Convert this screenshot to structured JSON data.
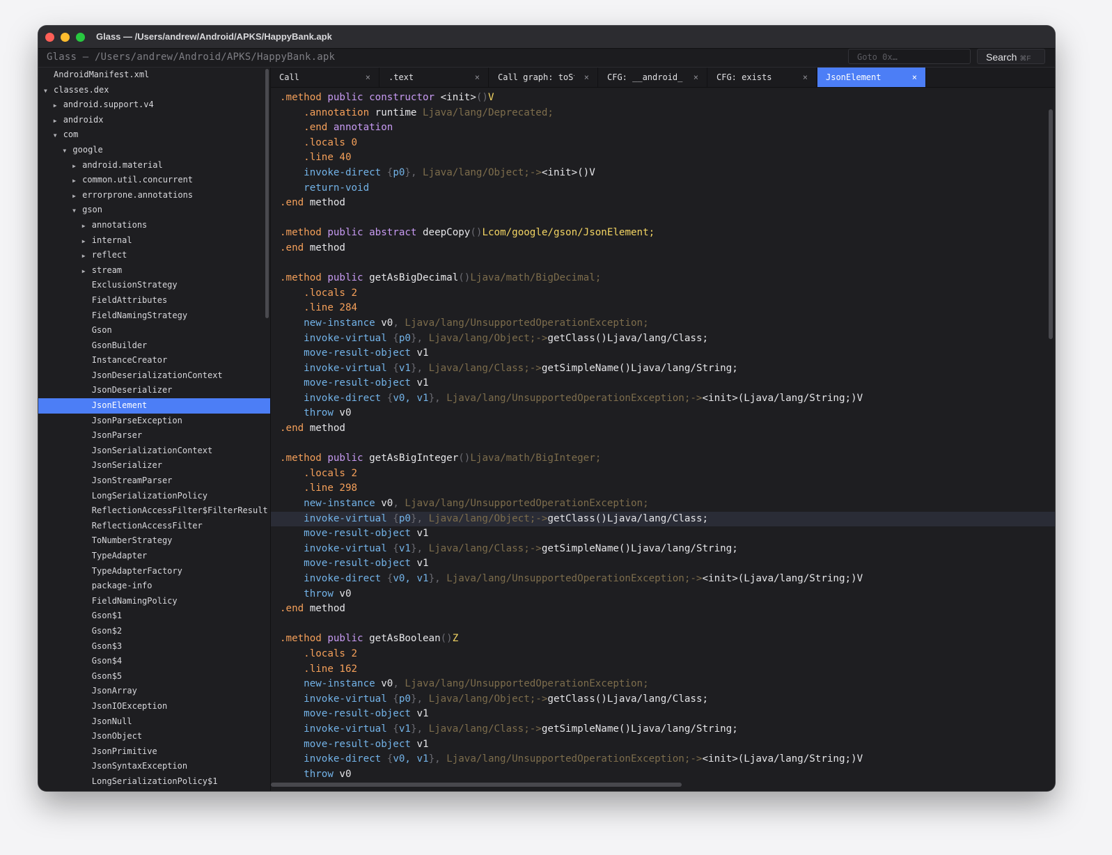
{
  "window": {
    "title": "Glass — /Users/andrew/Android/APKS/HappyBank.apk"
  },
  "pathbar": {
    "path": "Glass — /Users/andrew/Android/APKS/HappyBank.apk",
    "goto_placeholder": "Goto 0x…",
    "search_label": "Search",
    "search_shortcut": "⌘F"
  },
  "tree": [
    {
      "label": "AndroidManifest.xml",
      "depth": 0,
      "arrow": ""
    },
    {
      "label": "classes.dex",
      "depth": 0,
      "arrow": "down"
    },
    {
      "label": "android.support.v4",
      "depth": 1,
      "arrow": "right"
    },
    {
      "label": "androidx",
      "depth": 1,
      "arrow": "right"
    },
    {
      "label": "com",
      "depth": 1,
      "arrow": "down"
    },
    {
      "label": "google",
      "depth": 2,
      "arrow": "down"
    },
    {
      "label": "android.material",
      "depth": 3,
      "arrow": "right"
    },
    {
      "label": "common.util.concurrent",
      "depth": 3,
      "arrow": "right"
    },
    {
      "label": "errorprone.annotations",
      "depth": 3,
      "arrow": "right"
    },
    {
      "label": "gson",
      "depth": 3,
      "arrow": "down"
    },
    {
      "label": "annotations",
      "depth": 4,
      "arrow": "right"
    },
    {
      "label": "internal",
      "depth": 4,
      "arrow": "right"
    },
    {
      "label": "reflect",
      "depth": 4,
      "arrow": "right"
    },
    {
      "label": "stream",
      "depth": 4,
      "arrow": "right"
    },
    {
      "label": "ExclusionStrategy",
      "depth": 4,
      "arrow": ""
    },
    {
      "label": "FieldAttributes",
      "depth": 4,
      "arrow": ""
    },
    {
      "label": "FieldNamingStrategy",
      "depth": 4,
      "arrow": ""
    },
    {
      "label": "Gson",
      "depth": 4,
      "arrow": ""
    },
    {
      "label": "GsonBuilder",
      "depth": 4,
      "arrow": ""
    },
    {
      "label": "InstanceCreator",
      "depth": 4,
      "arrow": ""
    },
    {
      "label": "JsonDeserializationContext",
      "depth": 4,
      "arrow": ""
    },
    {
      "label": "JsonDeserializer",
      "depth": 4,
      "arrow": ""
    },
    {
      "label": "JsonElement",
      "depth": 4,
      "arrow": "",
      "selected": true
    },
    {
      "label": "JsonParseException",
      "depth": 4,
      "arrow": ""
    },
    {
      "label": "JsonParser",
      "depth": 4,
      "arrow": ""
    },
    {
      "label": "JsonSerializationContext",
      "depth": 4,
      "arrow": ""
    },
    {
      "label": "JsonSerializer",
      "depth": 4,
      "arrow": ""
    },
    {
      "label": "JsonStreamParser",
      "depth": 4,
      "arrow": ""
    },
    {
      "label": "LongSerializationPolicy",
      "depth": 4,
      "arrow": ""
    },
    {
      "label": "ReflectionAccessFilter$FilterResult",
      "depth": 4,
      "arrow": ""
    },
    {
      "label": "ReflectionAccessFilter",
      "depth": 4,
      "arrow": ""
    },
    {
      "label": "ToNumberStrategy",
      "depth": 4,
      "arrow": ""
    },
    {
      "label": "TypeAdapter",
      "depth": 4,
      "arrow": ""
    },
    {
      "label": "TypeAdapterFactory",
      "depth": 4,
      "arrow": ""
    },
    {
      "label": "package-info",
      "depth": 4,
      "arrow": ""
    },
    {
      "label": "FieldNamingPolicy",
      "depth": 4,
      "arrow": ""
    },
    {
      "label": "Gson$1",
      "depth": 4,
      "arrow": ""
    },
    {
      "label": "Gson$2",
      "depth": 4,
      "arrow": ""
    },
    {
      "label": "Gson$3",
      "depth": 4,
      "arrow": ""
    },
    {
      "label": "Gson$4",
      "depth": 4,
      "arrow": ""
    },
    {
      "label": "Gson$5",
      "depth": 4,
      "arrow": ""
    },
    {
      "label": "JsonArray",
      "depth": 4,
      "arrow": ""
    },
    {
      "label": "JsonIOException",
      "depth": 4,
      "arrow": ""
    },
    {
      "label": "JsonNull",
      "depth": 4,
      "arrow": ""
    },
    {
      "label": "JsonObject",
      "depth": 4,
      "arrow": ""
    },
    {
      "label": "JsonPrimitive",
      "depth": 4,
      "arrow": ""
    },
    {
      "label": "JsonSyntaxException",
      "depth": 4,
      "arrow": ""
    },
    {
      "label": "LongSerializationPolicy$1",
      "depth": 4,
      "arrow": ""
    }
  ],
  "tabs": [
    {
      "label": "Call",
      "close": "×"
    },
    {
      "label": ".text",
      "close": "×"
    },
    {
      "label": "Call graph: toSt",
      "close": "×"
    },
    {
      "label": "CFG: __android_",
      "close": "×"
    },
    {
      "label": "CFG: exists",
      "close": "×"
    },
    {
      "label": "JsonElement",
      "close": "×",
      "active": true
    }
  ],
  "code_lines": [
    [
      [
        "dir",
        ".method "
      ],
      [
        "kw",
        "public constructor "
      ],
      [
        "pl",
        "<init>"
      ],
      [
        "punc",
        "()"
      ],
      [
        "hi",
        "V"
      ]
    ],
    [
      [
        "pl",
        "    "
      ],
      [
        "dir",
        ".annotation "
      ],
      [
        "pl",
        "runtime "
      ],
      [
        "ty",
        "Ljava/lang/Deprecated;"
      ]
    ],
    [
      [
        "pl",
        "    "
      ],
      [
        "dir",
        ".end "
      ],
      [
        "kw",
        "annotation"
      ]
    ],
    [
      [
        "pl",
        "    "
      ],
      [
        "dir",
        ".locals "
      ],
      [
        "num",
        "0"
      ]
    ],
    [
      [
        "pl",
        "    "
      ],
      [
        "dir",
        ".line "
      ],
      [
        "num",
        "40"
      ]
    ],
    [
      [
        "pl",
        "    "
      ],
      [
        "op",
        "invoke-direct "
      ],
      [
        "punc",
        "{"
      ],
      [
        "op",
        "p0"
      ],
      [
        "punc",
        "}, "
      ],
      [
        "ty",
        "Ljava/lang/Object;->"
      ],
      [
        "pl",
        "<init>()V"
      ]
    ],
    [
      [
        "pl",
        "    "
      ],
      [
        "op",
        "return-void"
      ]
    ],
    [
      [
        "dir",
        ".end "
      ],
      [
        "pl",
        "method"
      ]
    ],
    [],
    [
      [
        "dir",
        ".method "
      ],
      [
        "kw",
        "public abstract "
      ],
      [
        "pl",
        "deepCopy"
      ],
      [
        "punc",
        "()"
      ],
      [
        "hi",
        "Lcom/google/gson/JsonElement;"
      ]
    ],
    [
      [
        "dir",
        ".end "
      ],
      [
        "pl",
        "method"
      ]
    ],
    [],
    [
      [
        "dir",
        ".method "
      ],
      [
        "kw",
        "public "
      ],
      [
        "pl",
        "getAsBigDecimal"
      ],
      [
        "punc",
        "()"
      ],
      [
        "ty",
        "Ljava/math/BigDecimal;"
      ]
    ],
    [
      [
        "pl",
        "    "
      ],
      [
        "dir",
        ".locals "
      ],
      [
        "num",
        "2"
      ]
    ],
    [
      [
        "pl",
        "    "
      ],
      [
        "dir",
        ".line "
      ],
      [
        "num",
        "284"
      ]
    ],
    [
      [
        "pl",
        "    "
      ],
      [
        "op",
        "new-instance "
      ],
      [
        "pl",
        "v0"
      ],
      [
        "punc",
        ", "
      ],
      [
        "ty",
        "Ljava/lang/UnsupportedOperationException;"
      ]
    ],
    [
      [
        "pl",
        "    "
      ],
      [
        "op",
        "invoke-virtual "
      ],
      [
        "punc",
        "{"
      ],
      [
        "op",
        "p0"
      ],
      [
        "punc",
        "}, "
      ],
      [
        "ty",
        "Ljava/lang/Object;->"
      ],
      [
        "pl",
        "getClass()Ljava/lang/Class;"
      ]
    ],
    [
      [
        "pl",
        "    "
      ],
      [
        "op",
        "move-result-object "
      ],
      [
        "pl",
        "v1"
      ]
    ],
    [
      [
        "pl",
        "    "
      ],
      [
        "op",
        "invoke-virtual "
      ],
      [
        "punc",
        "{"
      ],
      [
        "op",
        "v1"
      ],
      [
        "punc",
        "}, "
      ],
      [
        "ty",
        "Ljava/lang/Class;->"
      ],
      [
        "pl",
        "getSimpleName()Ljava/lang/String;"
      ]
    ],
    [
      [
        "pl",
        "    "
      ],
      [
        "op",
        "move-result-object "
      ],
      [
        "pl",
        "v1"
      ]
    ],
    [
      [
        "pl",
        "    "
      ],
      [
        "op",
        "invoke-direct "
      ],
      [
        "punc",
        "{"
      ],
      [
        "op",
        "v0, v1"
      ],
      [
        "punc",
        "}, "
      ],
      [
        "ty",
        "Ljava/lang/UnsupportedOperationException;->"
      ],
      [
        "pl",
        "<init>(Ljava/lang/String;)V"
      ]
    ],
    [
      [
        "pl",
        "    "
      ],
      [
        "op",
        "throw "
      ],
      [
        "pl",
        "v0"
      ]
    ],
    [
      [
        "dir",
        ".end "
      ],
      [
        "pl",
        "method"
      ]
    ],
    [],
    [
      [
        "dir",
        ".method "
      ],
      [
        "kw",
        "public "
      ],
      [
        "pl",
        "getAsBigInteger"
      ],
      [
        "punc",
        "()"
      ],
      [
        "ty",
        "Ljava/math/BigInteger;"
      ]
    ],
    [
      [
        "pl",
        "    "
      ],
      [
        "dir",
        ".locals "
      ],
      [
        "num",
        "2"
      ]
    ],
    [
      [
        "pl",
        "    "
      ],
      [
        "dir",
        ".line "
      ],
      [
        "num",
        "298"
      ]
    ],
    [
      [
        "pl",
        "    "
      ],
      [
        "op",
        "new-instance "
      ],
      [
        "pl",
        "v0"
      ],
      [
        "punc",
        ", "
      ],
      [
        "ty",
        "Ljava/lang/UnsupportedOperationException;"
      ]
    ],
    [
      [
        "pl",
        "    "
      ],
      [
        "op",
        "invoke-virtual "
      ],
      [
        "punc",
        "{"
      ],
      [
        "op",
        "p0"
      ],
      [
        "punc",
        "}, "
      ],
      [
        "ty",
        "Ljava/lang/Object;->"
      ],
      [
        "pl",
        "getClass()Ljava/lang/Class;"
      ]
    ],
    [
      [
        "pl",
        "    "
      ],
      [
        "op",
        "move-result-object "
      ],
      [
        "pl",
        "v1"
      ]
    ],
    [
      [
        "pl",
        "    "
      ],
      [
        "op",
        "invoke-virtual "
      ],
      [
        "punc",
        "{"
      ],
      [
        "op",
        "v1"
      ],
      [
        "punc",
        "}, "
      ],
      [
        "ty",
        "Ljava/lang/Class;->"
      ],
      [
        "pl",
        "getSimpleName()Ljava/lang/String;"
      ]
    ],
    [
      [
        "pl",
        "    "
      ],
      [
        "op",
        "move-result-object "
      ],
      [
        "pl",
        "v1"
      ]
    ],
    [
      [
        "pl",
        "    "
      ],
      [
        "op",
        "invoke-direct "
      ],
      [
        "punc",
        "{"
      ],
      [
        "op",
        "v0, v1"
      ],
      [
        "punc",
        "}, "
      ],
      [
        "ty",
        "Ljava/lang/UnsupportedOperationException;->"
      ],
      [
        "pl",
        "<init>(Ljava/lang/String;)V"
      ]
    ],
    [
      [
        "pl",
        "    "
      ],
      [
        "op",
        "throw "
      ],
      [
        "pl",
        "v0"
      ]
    ],
    [
      [
        "dir",
        ".end "
      ],
      [
        "pl",
        "method"
      ]
    ],
    [],
    [
      [
        "dir",
        ".method "
      ],
      [
        "kw",
        "public "
      ],
      [
        "pl",
        "getAsBoolean"
      ],
      [
        "punc",
        "()"
      ],
      [
        "hi",
        "Z"
      ]
    ],
    [
      [
        "pl",
        "    "
      ],
      [
        "dir",
        ".locals "
      ],
      [
        "num",
        "2"
      ]
    ],
    [
      [
        "pl",
        "    "
      ],
      [
        "dir",
        ".line "
      ],
      [
        "num",
        "162"
      ]
    ],
    [
      [
        "pl",
        "    "
      ],
      [
        "op",
        "new-instance "
      ],
      [
        "pl",
        "v0"
      ],
      [
        "punc",
        ", "
      ],
      [
        "ty",
        "Ljava/lang/UnsupportedOperationException;"
      ]
    ],
    [
      [
        "pl",
        "    "
      ],
      [
        "op",
        "invoke-virtual "
      ],
      [
        "punc",
        "{"
      ],
      [
        "op",
        "p0"
      ],
      [
        "punc",
        "}, "
      ],
      [
        "ty",
        "Ljava/lang/Object;->"
      ],
      [
        "pl",
        "getClass()Ljava/lang/Class;"
      ]
    ],
    [
      [
        "pl",
        "    "
      ],
      [
        "op",
        "move-result-object "
      ],
      [
        "pl",
        "v1"
      ]
    ],
    [
      [
        "pl",
        "    "
      ],
      [
        "op",
        "invoke-virtual "
      ],
      [
        "punc",
        "{"
      ],
      [
        "op",
        "v1"
      ],
      [
        "punc",
        "}, "
      ],
      [
        "ty",
        "Ljava/lang/Class;->"
      ],
      [
        "pl",
        "getSimpleName()Ljava/lang/String;"
      ]
    ],
    [
      [
        "pl",
        "    "
      ],
      [
        "op",
        "move-result-object "
      ],
      [
        "pl",
        "v1"
      ]
    ],
    [
      [
        "pl",
        "    "
      ],
      [
        "op",
        "invoke-direct "
      ],
      [
        "punc",
        "{"
      ],
      [
        "op",
        "v0, v1"
      ],
      [
        "punc",
        "}, "
      ],
      [
        "ty",
        "Ljava/lang/UnsupportedOperationException;->"
      ],
      [
        "pl",
        "<init>(Ljava/lang/String;)V"
      ]
    ],
    [
      [
        "pl",
        "    "
      ],
      [
        "op",
        "throw "
      ],
      [
        "pl",
        "v0"
      ]
    ]
  ],
  "highlighted_line": 28,
  "colors": {
    "accent": "#4c7ef6",
    "directive": "#f5a05a",
    "keyword": "#c79af2",
    "opcode": "#73b3e8",
    "type": "#7d6d4c",
    "return_type": "#f4d563"
  }
}
